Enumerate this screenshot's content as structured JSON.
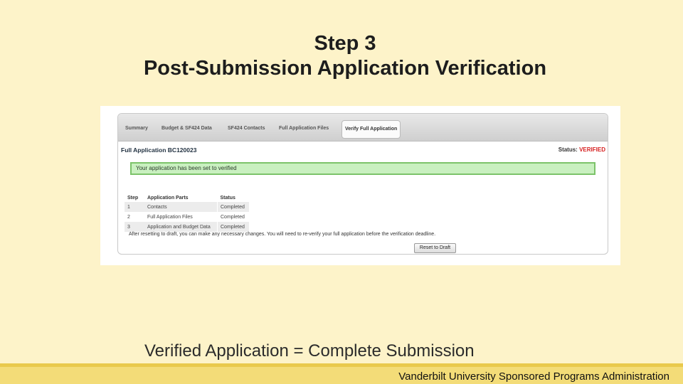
{
  "slide": {
    "title_line1": "Step 3",
    "title_line2": "Post-Submission Application Verification",
    "caption": "Verified Application = Complete Submission",
    "footer": "Vanderbilt University Sponsored Programs Administration"
  },
  "screen": {
    "tabs": [
      {
        "label": "Summary",
        "active": false
      },
      {
        "label": "Budget & SF424 Data",
        "active": false
      },
      {
        "label": "SF424 Contacts",
        "active": false
      },
      {
        "label": "Full Application Files",
        "active": false
      },
      {
        "label": "Verify Full Application",
        "active": true
      }
    ],
    "app_title": "Full Application BC120023",
    "status_label": "Status:",
    "status_value": "VERIFIED",
    "alert": "Your application has been set to verified",
    "table": {
      "headers": [
        "Step",
        "Application Parts",
        "Status"
      ],
      "rows": [
        [
          "1",
          "Contacts",
          "Completed"
        ],
        [
          "2",
          "Full Application Files",
          "Completed"
        ],
        [
          "3",
          "Application and Budget Data",
          "Completed"
        ]
      ]
    },
    "note": "After resetting to draft, you can make any necessary changes. You will need to re-verify your full application before the verification deadline.",
    "reset_button": "Reset to Draft"
  },
  "colors": {
    "background": "#fdf3c9",
    "status_verified": "#d62020",
    "alert_bg": "#c9f0c0",
    "alert_border": "#7cc36a",
    "bottom_band": "#f3dc78"
  }
}
